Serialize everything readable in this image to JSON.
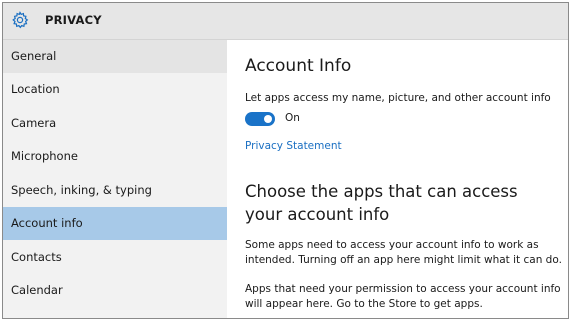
{
  "titlebar": {
    "icon": "gear-icon",
    "title": "PRIVACY"
  },
  "sidebar": {
    "items": [
      {
        "label": "General"
      },
      {
        "label": "Location"
      },
      {
        "label": "Camera"
      },
      {
        "label": "Microphone"
      },
      {
        "label": "Speech, inking, & typing"
      },
      {
        "label": "Account info",
        "selected": true
      },
      {
        "label": "Contacts"
      },
      {
        "label": "Calendar"
      }
    ]
  },
  "main": {
    "heading": "Account Info",
    "toggle_description": "Let apps access my name, picture, and other account info",
    "toggle_state": "On",
    "toggle_on": true,
    "privacy_link": "Privacy Statement",
    "subheading": "Choose the apps that can access your account info",
    "paragraph1": "Some apps need to access your account info to work as intended. Turning off an app here might limit what it can do.",
    "paragraph2": "Apps that need your permission to access your account info will appear here. Go to the Store to get apps."
  },
  "colors": {
    "accent": "#1a73c8",
    "link": "#1a6fc2",
    "selected_item": "#a7c9e8",
    "sidebar_bg": "#f2f2f2",
    "titlebar_bg": "#e6e6e6"
  }
}
